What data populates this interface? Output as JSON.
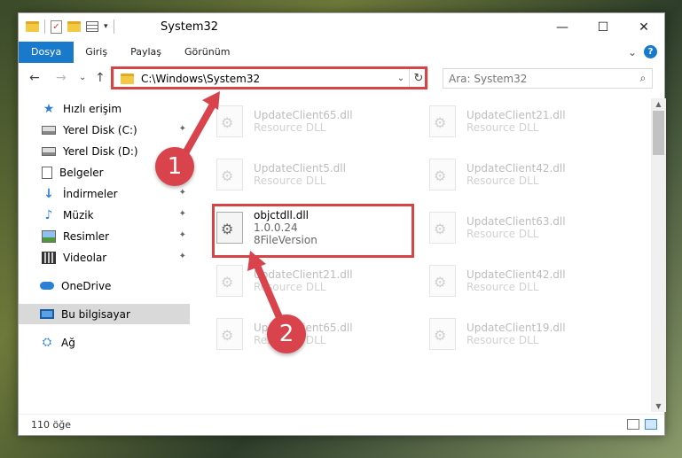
{
  "window": {
    "title": "System32",
    "controls": {
      "minimize": "—",
      "maximize": "☐",
      "close": "✕"
    }
  },
  "ribbon": {
    "tabs": [
      "Dosya",
      "Giriş",
      "Paylaş",
      "Görünüm"
    ],
    "expand": "⌄",
    "help": "?"
  },
  "navigation": {
    "back": "←",
    "forward": "→",
    "recent": "⌄",
    "up": "↑",
    "address": "C:\\Windows\\System32",
    "address_dropdown": "⌄",
    "refresh": "↻",
    "search_placeholder": "Ara: System32",
    "search_icon": "🔍"
  },
  "sidebar": {
    "items": [
      {
        "label": "Hızlı erişim",
        "icon": "star-icon"
      },
      {
        "label": "Yerel Disk (C:)",
        "icon": "disk-icon",
        "pinned": true
      },
      {
        "label": "Yerel Disk (D:)",
        "icon": "disk-icon"
      },
      {
        "label": "Belgeler",
        "icon": "document-icon"
      },
      {
        "label": "İndirmeler",
        "icon": "download-icon",
        "pinned": true
      },
      {
        "label": "Müzik",
        "icon": "music-icon",
        "pinned": true
      },
      {
        "label": "Resimler",
        "icon": "pictures-icon",
        "pinned": true
      },
      {
        "label": "Videolar",
        "icon": "videos-icon",
        "pinned": true
      },
      {
        "label": "OneDrive",
        "icon": "cloud-icon"
      },
      {
        "label": "Bu bilgisayar",
        "icon": "computer-icon",
        "selected": true
      },
      {
        "label": "Ağ",
        "icon": "network-icon"
      }
    ],
    "pin_glyph": "📌"
  },
  "files": [
    {
      "name": "UpdateClient65.dll",
      "desc": "Resource DLL"
    },
    {
      "name": "UpdateClient21.dll",
      "desc": "Resource DLL"
    },
    {
      "name": "UpdateClient5.dll",
      "desc": "Resource DLL"
    },
    {
      "name": "UpdateClient42.dll",
      "desc": "Resource DLL"
    },
    {
      "name": "objctdll.dll",
      "desc": "1.0.0.24",
      "extra": "8FileVersion",
      "focus": true
    },
    {
      "name": "UpdateClient63.dll",
      "desc": "Resource DLL"
    },
    {
      "name": "UpdateClient21.dll",
      "desc": "Resource DLL"
    },
    {
      "name": "UpdateClient42.dll",
      "desc": "Resource DLL"
    },
    {
      "name": "UpdateClient65.dll",
      "desc": "Resource DLL"
    },
    {
      "name": "UpdateClient19.dll",
      "desc": "Resource DLL"
    }
  ],
  "status": {
    "item_count": "110 öğe"
  },
  "annotations": [
    {
      "number": "1",
      "color": "#d8434c"
    },
    {
      "number": "2",
      "color": "#d8434c"
    }
  ],
  "colors": {
    "accent": "#1979ca",
    "highlight": "#d64545"
  }
}
